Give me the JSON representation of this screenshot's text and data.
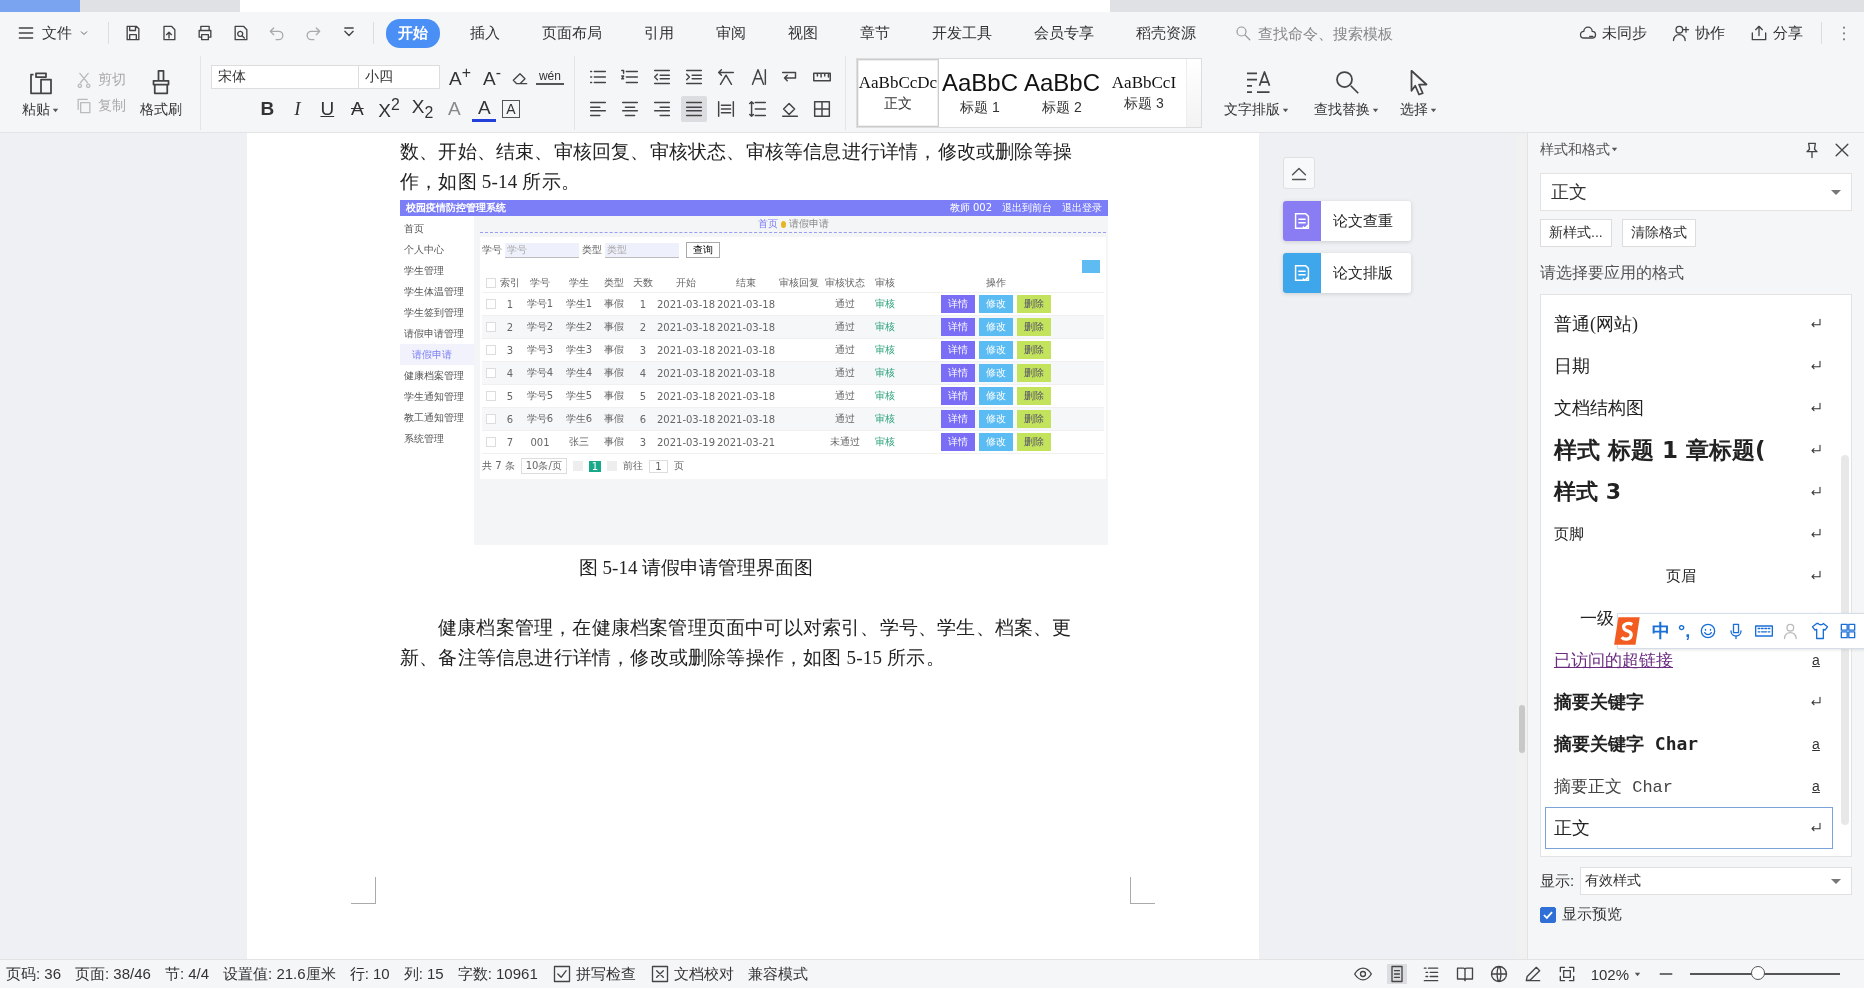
{
  "menu": {
    "file": "文件",
    "tabs": [
      {
        "label": "开始",
        "selected": true
      },
      {
        "label": "插入",
        "selected": false
      },
      {
        "label": "页面布局",
        "selected": false
      },
      {
        "label": "引用",
        "selected": false
      },
      {
        "label": "审阅",
        "selected": false
      },
      {
        "label": "视图",
        "selected": false
      },
      {
        "label": "章节",
        "selected": false
      },
      {
        "label": "开发工具",
        "selected": false
      },
      {
        "label": "会员专享",
        "selected": false
      },
      {
        "label": "稻壳资源",
        "selected": false
      }
    ],
    "search": {
      "placeholder": "查找命令、搜索模板"
    },
    "actions": [
      {
        "label": "未同步",
        "kind": "cloud"
      },
      {
        "label": "协作",
        "kind": "people"
      },
      {
        "label": "分享",
        "kind": "share"
      }
    ]
  },
  "ribbon": {
    "paste": "粘贴",
    "cut": "剪切",
    "copy": "复制",
    "format_painter": "格式刷",
    "font": "宋体",
    "size": "小四",
    "grow": "A$^{+}$",
    "shrink": "A$^{-}$",
    "pinyin": "wén",
    "font_buttons": [
      {
        "label": "B",
        "kind": "bold"
      },
      {
        "label": "I",
        "kind": "italic"
      },
      {
        "label": "U",
        "kind": "underline"
      },
      {
        "label": "A",
        "kind": "strike"
      },
      {
        "label": "X$^{2}$",
        "kind": "plain"
      },
      {
        "label": "X$_{2}$",
        "kind": "plain"
      },
      {
        "label": "A",
        "kind": "effect"
      },
      {
        "label": "A",
        "kind": "color"
      },
      {
        "label": "A",
        "kind": "boxed"
      }
    ],
    "align": [
      {
        "kind": "left",
        "selected": false
      },
      {
        "kind": "center",
        "selected": false
      },
      {
        "kind": "right",
        "selected": false
      },
      {
        "kind": "justify",
        "selected": true
      },
      {
        "kind": "distributed",
        "selected": false
      }
    ],
    "styles": [
      {
        "sample": "AaBbCcDc",
        "label": "正文",
        "selected": true
      },
      {
        "sample": "AaBbC",
        "label": "标题 1",
        "selected": false
      },
      {
        "sample": "AaBbC",
        "label": "标题 2",
        "selected": false
      },
      {
        "sample": "AaBbCcI",
        "label": "标题 3",
        "selected": false
      }
    ],
    "text_layout": "文字排版",
    "find_replace": "查找替换",
    "select": "选择"
  },
  "document": {
    "paragraphs_before": [
      "数、开始、结束、审核回复、审核状态、审核等信息进行详情，修改或删除等操",
      "作，如图 5-14 所示。"
    ],
    "figure": {
      "title": "校园疫情防控管理系统",
      "links": [
        "教师 002",
        "退出到前台",
        "退出登录"
      ],
      "sidebar": [
        {
          "label": "首页",
          "selected": false
        },
        {
          "label": "个人中心",
          "selected": false
        },
        {
          "label": "学生管理",
          "selected": false
        },
        {
          "label": "学生体温管理",
          "selected": false
        },
        {
          "label": "学生签到管理",
          "selected": false
        },
        {
          "label": "请假申请管理",
          "selected": false,
          "children": [
            {
              "label": "请假申请",
              "selected": true
            }
          ]
        },
        {
          "label": "健康档案管理",
          "selected": false
        },
        {
          "label": "学生通知管理",
          "selected": false
        },
        {
          "label": "教工通知管理",
          "selected": false
        },
        {
          "label": "系统管理",
          "selected": false
        }
      ],
      "breadcrumb": [
        "首页",
        "请假申请"
      ],
      "filters": [
        {
          "label": "学号",
          "placeholder": "学号"
        },
        {
          "label": "类型",
          "placeholder": "类型"
        }
      ],
      "query": "查询",
      "select_all": {
        "checked": false
      },
      "columns": [
        "索引",
        "学号",
        "学生",
        "类型",
        "天数",
        "开始",
        "结束",
        "审核回复",
        "审核状态",
        "审核",
        "操作"
      ],
      "rows": [
        {
          "checked": false,
          "cells": [
            "1",
            "学号1",
            "学生1",
            "事假",
            "1",
            "2021-03-18",
            "2021-03-18",
            "",
            "通过"
          ],
          "review": "审核",
          "actions": [
            "详情",
            "修改",
            "删除"
          ]
        },
        {
          "checked": false,
          "cells": [
            "2",
            "学号2",
            "学生2",
            "事假",
            "2",
            "2021-03-18",
            "2021-03-18",
            "",
            "通过"
          ],
          "review": "审核",
          "actions": [
            "详情",
            "修改",
            "删除"
          ]
        },
        {
          "checked": false,
          "cells": [
            "3",
            "学号3",
            "学生3",
            "事假",
            "3",
            "2021-03-18",
            "2021-03-18",
            "",
            "通过"
          ],
          "review": "审核",
          "actions": [
            "详情",
            "修改",
            "删除"
          ]
        },
        {
          "checked": false,
          "cells": [
            "4",
            "学号4",
            "学生4",
            "事假",
            "4",
            "2021-03-18",
            "2021-03-18",
            "",
            "通过"
          ],
          "review": "审核",
          "actions": [
            "详情",
            "修改",
            "删除"
          ]
        },
        {
          "checked": false,
          "cells": [
            "5",
            "学号5",
            "学生5",
            "事假",
            "5",
            "2021-03-18",
            "2021-03-18",
            "",
            "通过"
          ],
          "review": "审核",
          "actions": [
            "详情",
            "修改",
            "删除"
          ]
        },
        {
          "checked": false,
          "cells": [
            "6",
            "学号6",
            "学生6",
            "事假",
            "6",
            "2021-03-18",
            "2021-03-18",
            "",
            "通过"
          ],
          "review": "审核",
          "actions": [
            "详情",
            "修改",
            "删除"
          ]
        },
        {
          "checked": false,
          "cells": [
            "7",
            "001",
            "张三",
            "事假",
            "3",
            "2021-03-19",
            "2021-03-21",
            "",
            "未通过"
          ],
          "review": "审核",
          "actions": [
            "详情",
            "修改",
            "删除"
          ]
        }
      ],
      "pager": {
        "total": "共 7 条",
        "per_page": "10条/页",
        "pages": [
          {
            "label": "1",
            "selected": true
          }
        ],
        "goto": "前往",
        "goto_value": "1",
        "unit": "页"
      }
    },
    "caption": "图 5-14 请假申请管理界面图",
    "paragraphs_after": [
      "健康档案管理，在健康档案管理页面中可以对索引、学号、学生、档案、更",
      "新、备注等信息进行详情，修改或删除等操作，如图 5-15 所示。"
    ]
  },
  "side_buttons": [
    {
      "label": "论文查重",
      "color": "#8a7cf2"
    },
    {
      "label": "论文排版",
      "color": "#3ea6ea"
    }
  ],
  "style_panel": {
    "title": "样式和格式",
    "current": "正文",
    "buttons": [
      "新样式...",
      "清除格式"
    ],
    "prompt": "请选择要应用的格式",
    "items": [
      {
        "label": "普通(网站)",
        "kind": "serif",
        "selected": false
      },
      {
        "label": "日期",
        "kind": "serif",
        "selected": false
      },
      {
        "label": "文档结构图",
        "kind": "serif",
        "selected": false
      },
      {
        "label": "样式  标题 1 章标题(",
        "kind": "heading",
        "selected": false
      },
      {
        "label": "样式 3",
        "kind": "bold-large",
        "selected": false
      },
      {
        "label": "页脚",
        "kind": "small",
        "selected": false
      },
      {
        "label": "页眉",
        "kind": "centered",
        "selected": false
      },
      {
        "label": "一级",
        "kind": "indented",
        "selected": false
      },
      {
        "label": "已访问的超链接",
        "kind": "link",
        "mark": "a",
        "selected": false
      },
      {
        "label": "摘要关键字",
        "kind": "bold",
        "selected": false
      },
      {
        "label": "摘要关键字 Char",
        "kind": "bold-mono",
        "mark": "a",
        "selected": false
      },
      {
        "label": "摘要正文 Char",
        "kind": "mono",
        "mark": "a",
        "selected": false
      },
      {
        "label": "正文",
        "kind": "serif",
        "selected": true
      }
    ],
    "show_label": "显示:",
    "show_value": "有效样式",
    "preview": {
      "label": "显示预览",
      "checked": true
    }
  },
  "ime": {
    "mode": "中",
    "punct": "°,"
  },
  "status_bar": {
    "items": [
      {
        "text": "页码: 36",
        "kind": "plain"
      },
      {
        "text": "页面: 38/46",
        "kind": "plain"
      },
      {
        "text": "节: 4/4",
        "kind": "plain"
      },
      {
        "text": "设置值: 21.6厘米",
        "kind": "plain"
      },
      {
        "text": "行: 10",
        "kind": "plain"
      },
      {
        "text": "列: 15",
        "kind": "plain"
      },
      {
        "text": "字数: 10961",
        "kind": "plain"
      },
      {
        "text": "拼写检查",
        "kind": "spell"
      },
      {
        "text": "文档校对",
        "kind": "proof"
      },
      {
        "text": "兼容模式",
        "kind": "plain"
      }
    ],
    "zoom": "102%",
    "zoom_slider": {
      "level": 0.45
    }
  }
}
